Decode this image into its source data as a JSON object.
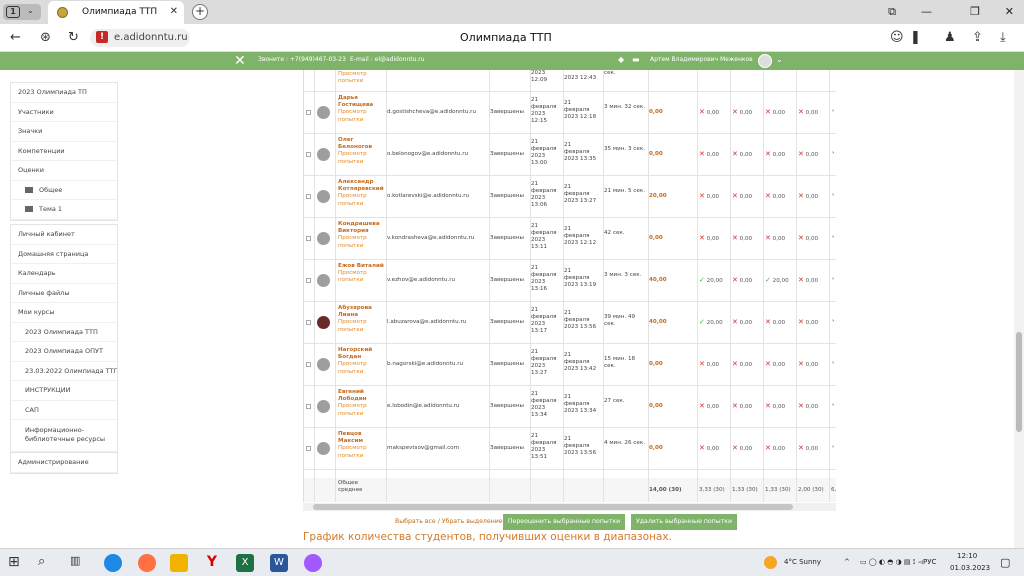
{
  "browser": {
    "tab_count": "1",
    "tab_title": "Олимпиада ТТП",
    "url": "e.adidonntu.ru",
    "page_title": "Олимпиада ТТП"
  },
  "topbar": {
    "phone": "Звоните : +7(949)467-03-23",
    "email": "E-mail : el@adidonntu.ru",
    "user": "Артем Владимирович Меженков"
  },
  "nav": {
    "box1": [
      "2023 Олимпиада ТП",
      "Участники",
      "Значки",
      "Компетенции",
      "Оценки",
      "Общее",
      "Тема 1"
    ],
    "box2": [
      "Личный кабинет",
      "Домашняя страница",
      "Календарь",
      "Личные файлы",
      "Мои курсы",
      "2023 Олимпиада ТТП",
      "2023 Олимпиада ОПУТ",
      "23.03.2022 Олимпиада ТТП",
      "ИНСТРУКЦИИ",
      "САП",
      "Информационно-библиотечные ресурсы"
    ],
    "box3": [
      "Администрирование"
    ]
  },
  "table": {
    "review": "Просмотр попытки",
    "status": "Завершены",
    "rows": [
      {
        "name": "Дарья Гостищева",
        "email": "d.gostishcheva@e.adidonntu.ru",
        "start": [
          "21",
          "февраля",
          "2023",
          "12:15"
        ],
        "end": [
          "21",
          "февраля",
          "2023 12:18"
        ],
        "dur": "3 мин. 32 сек.",
        "grade": "0,00",
        "q": [
          "✕ 0,00",
          "✕ 0,00",
          "✕ 0,00",
          "✕ 0,00"
        ],
        "photo": false
      },
      {
        "name": "Олег Белоногов",
        "email": "o.belonogov@e.adidonntu.ru",
        "start": [
          "21",
          "февраля",
          "2023",
          "13:00"
        ],
        "end": [
          "21",
          "февраля",
          "2023 13:35"
        ],
        "dur": "35 мин. 3 сек.",
        "grade": "0,00",
        "q": [
          "✕ 0,00",
          "✕ 0,00",
          "✕ 0,00",
          "✕ 0,00"
        ],
        "photo": false
      },
      {
        "name": "Александр Котляревский",
        "email": "o.kotlarevski@e.adidonntu.ru",
        "start": [
          "21",
          "февраля",
          "2023",
          "13:06"
        ],
        "end": [
          "21",
          "февраля",
          "2023 13:27"
        ],
        "dur": "21 мин. 5 сек.",
        "grade": "20,00",
        "q": [
          "✕ 0,00",
          "✕ 0,00",
          "✕ 0,00",
          "✕ 0,00"
        ],
        "photo": false
      },
      {
        "name": "Кондрашева Виктория",
        "email": "v.kondrasheva@e.adidonntu.ru",
        "start": [
          "21",
          "февраля",
          "2023",
          "13:11"
        ],
        "end": [
          "21",
          "февраля",
          "2023 12:12"
        ],
        "dur": "42 сек.",
        "grade": "0,00",
        "q": [
          "✕ 0,00",
          "✕ 0,00",
          "✕ 0,00",
          "✕ 0,00"
        ],
        "photo": false
      },
      {
        "name": "Ежов Виталий",
        "email": "v.ezhov@e.adidonntu.ru",
        "start": [
          "21",
          "февраля",
          "2023",
          "13:16"
        ],
        "end": [
          "21",
          "февраля",
          "2023 13:19"
        ],
        "dur": "3 мин. 3 сек.",
        "grade": "40,00",
        "q": [
          "✓ 20,00",
          "✕ 0,00",
          "✓ 20,00",
          "✕ 0,00"
        ],
        "photo": false
      },
      {
        "name": "Абузярова Лиана",
        "email": "l.abuzarova@e.adidonntu.ru",
        "start": [
          "21",
          "февраля",
          "2023",
          "13:17"
        ],
        "end": [
          "21",
          "февраля",
          "2023 13:56"
        ],
        "dur": "39 мин. 49 сек.",
        "grade": "40,00",
        "q": [
          "✓ 20,00",
          "✕ 0,00",
          "✕ 0,00",
          "✕ 0,00"
        ],
        "photo": true
      },
      {
        "name": "Нагорский Богдан",
        "email": "b.nagorski@e.adidonntu.ru",
        "start": [
          "21",
          "февраля",
          "2023",
          "13:27"
        ],
        "end": [
          "21",
          "февраля",
          "2023 13:42"
        ],
        "dur": "15 мин. 18 сек.",
        "grade": "0,00",
        "q": [
          "✕ 0,00",
          "✕ 0,00",
          "✕ 0,00",
          "✕ 0,00"
        ],
        "photo": false
      },
      {
        "name": "Евгений Лободин",
        "email": "e.lobodin@e.adidonntu.ru",
        "start": [
          "21",
          "февраля",
          "2023",
          "13:34"
        ],
        "end": [
          "21",
          "февраля",
          "2023 13:34"
        ],
        "dur": "27 сек.",
        "grade": "0,00",
        "q": [
          "✕ 0,00",
          "✕ 0,00",
          "✕ 0,00",
          "✕ 0,00"
        ],
        "photo": false
      },
      {
        "name": "Певцов Максим",
        "email": "makspevtsov@gmail.com",
        "start": [
          "21",
          "февраля",
          "2023",
          "13:51"
        ],
        "end": [
          "21",
          "февраля",
          "2023 13:56"
        ],
        "dur": "4 мин. 26 сек.",
        "grade": "0,00",
        "q": [
          "✕ 0,00",
          "✕ 0,00",
          "✕ 0,00",
          "✕ 0,00"
        ],
        "photo": false
      }
    ],
    "total_label": "Общее среднее",
    "totals": [
      "14,00 (30)",
      "3,33 (30)",
      "1,33 (30)",
      "1,33 (30)",
      "2,00 (30)",
      "6,"
    ]
  },
  "actions": {
    "select_all": "Выбрать все / Убрать выделение",
    "regrade": "Переоценить выбранные попытки",
    "delete": "Удалить выбранные попытки"
  },
  "section_heading": "График количества студентов, получивших оценки в диапазонах.",
  "taskbar": {
    "weather": "4°C Sunny",
    "lang": "РУС",
    "time": "12:10",
    "date": "01.03.2023"
  }
}
